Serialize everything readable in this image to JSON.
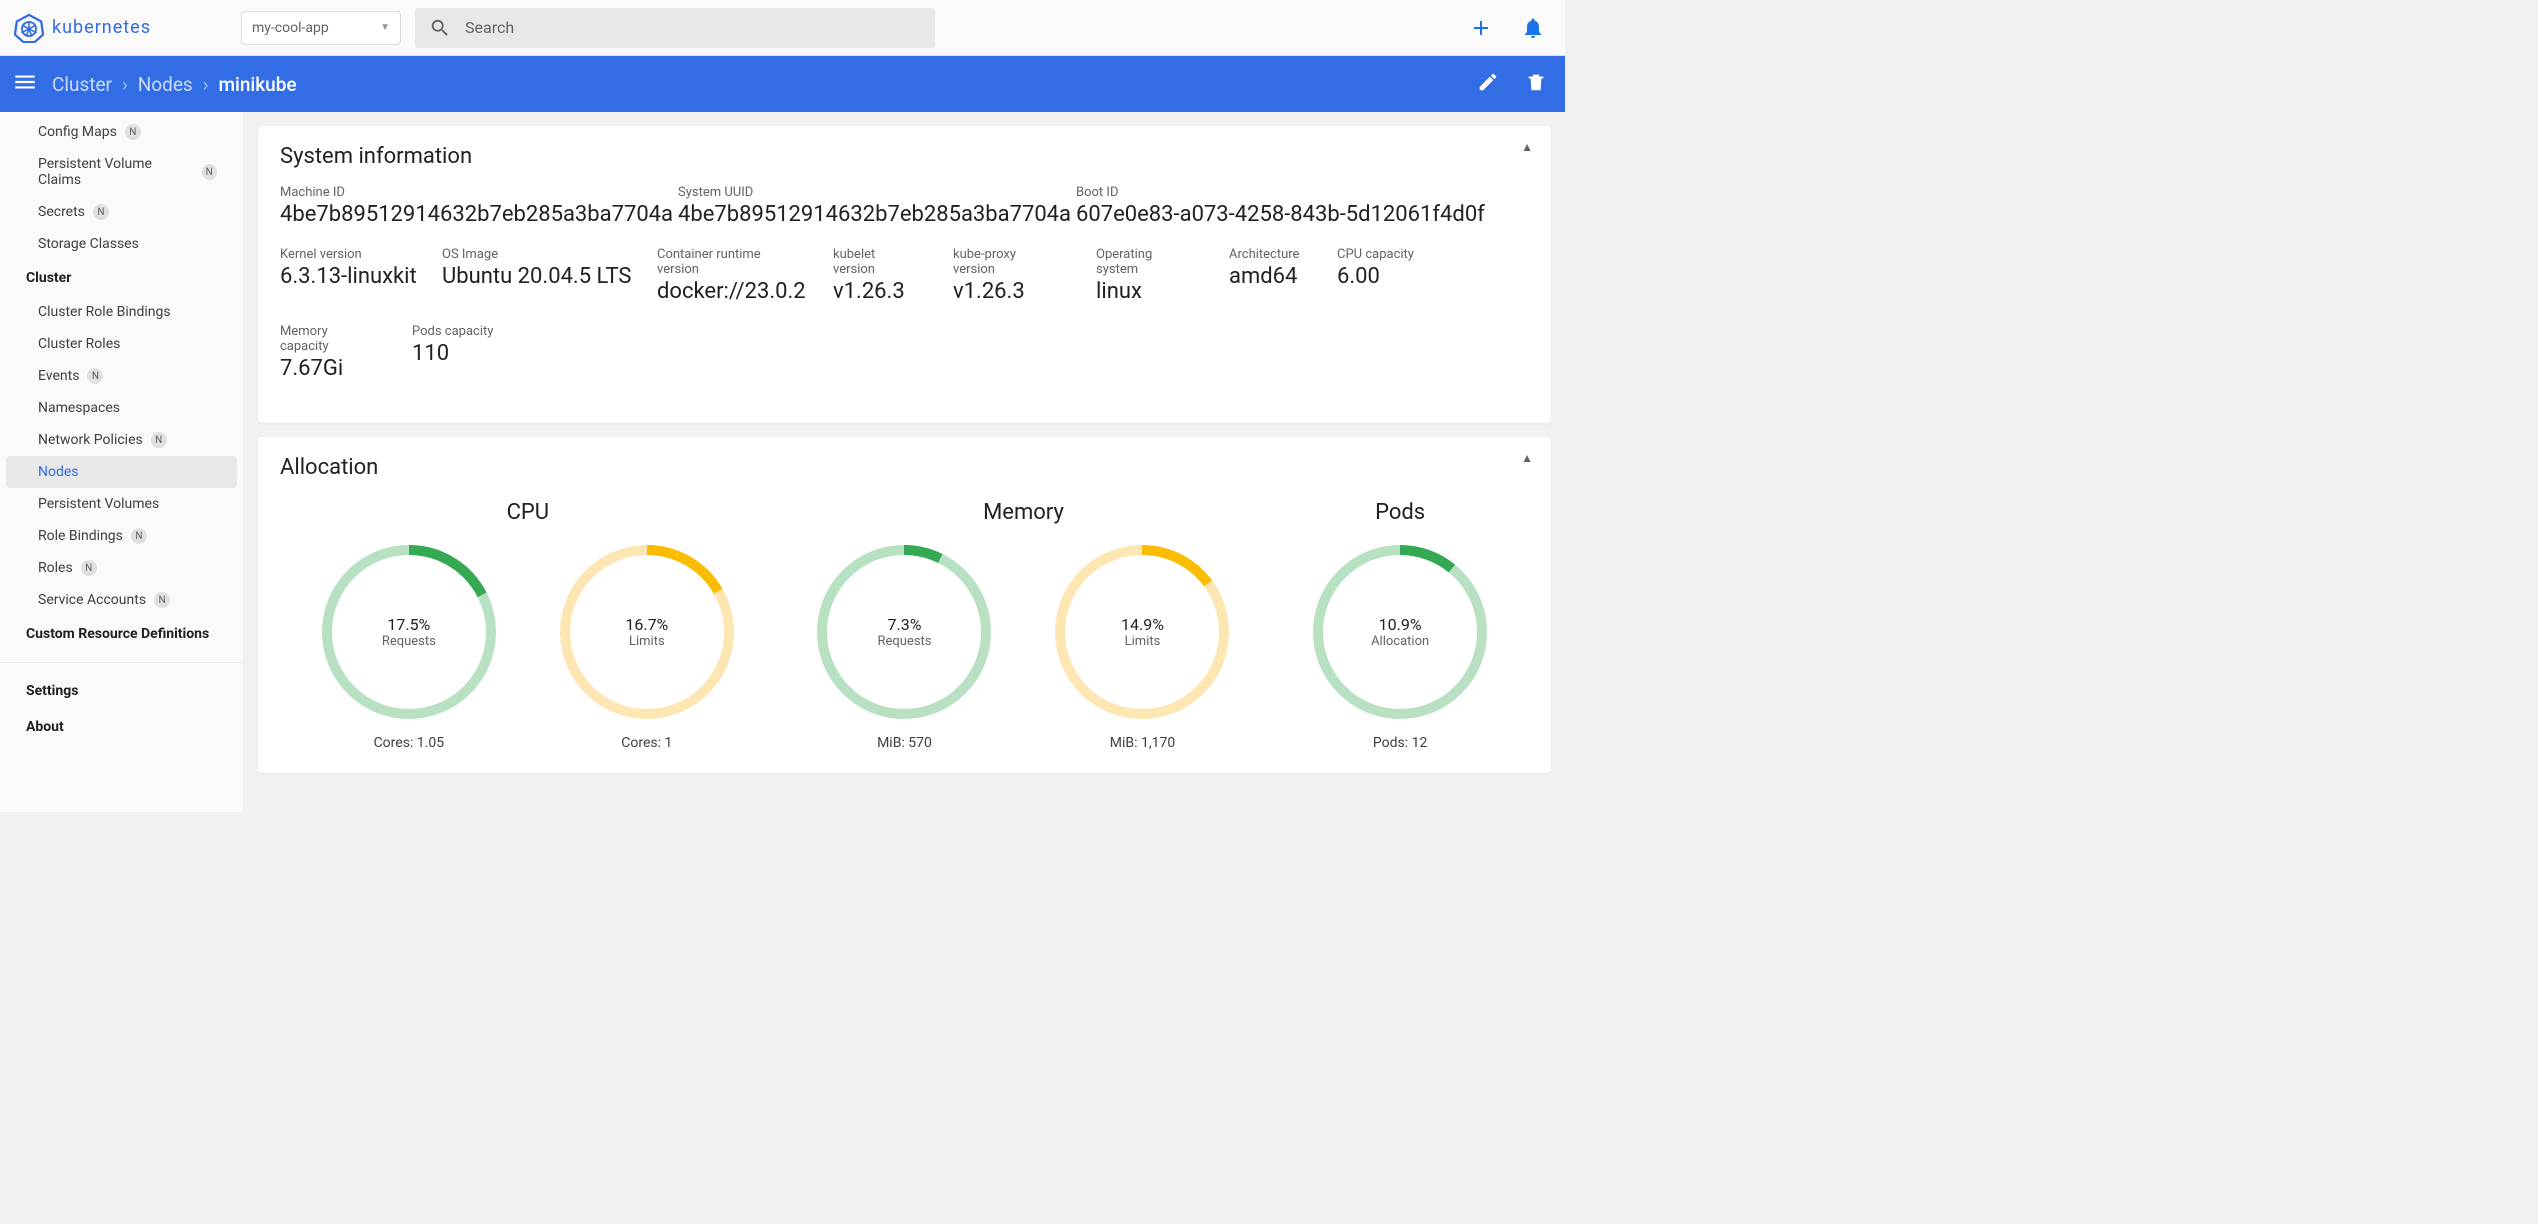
{
  "brand": "kubernetes",
  "namespace": "my-cool-app",
  "search_placeholder": "Search",
  "breadcrumb": {
    "cluster": "Cluster",
    "nodes": "Nodes",
    "current": "minikube"
  },
  "sidebar": {
    "items_top": [
      {
        "label": "Config Maps",
        "badge": "N"
      },
      {
        "label": "Persistent Volume Claims",
        "badge": "N"
      },
      {
        "label": "Secrets",
        "badge": "N"
      },
      {
        "label": "Storage Classes"
      }
    ],
    "cluster_title": "Cluster",
    "items_cluster": [
      {
        "label": "Cluster Role Bindings"
      },
      {
        "label": "Cluster Roles"
      },
      {
        "label": "Events",
        "badge": "N"
      },
      {
        "label": "Namespaces"
      },
      {
        "label": "Network Policies",
        "badge": "N"
      },
      {
        "label": "Nodes",
        "active": true
      },
      {
        "label": "Persistent Volumes"
      },
      {
        "label": "Role Bindings",
        "badge": "N"
      },
      {
        "label": "Roles",
        "badge": "N"
      },
      {
        "label": "Service Accounts",
        "badge": "N"
      }
    ],
    "crd_title": "Custom Resource Definitions",
    "settings": "Settings",
    "about": "About"
  },
  "sysinfo": {
    "title": "System information",
    "ids": {
      "machine_id_label": "Machine ID",
      "machine_id": "4be7b89512914632b7eb285a3ba7704a",
      "system_uuid_label": "System UUID",
      "system_uuid": "4be7b89512914632b7eb285a3ba7704a",
      "boot_id_label": "Boot ID",
      "boot_id": "607e0e83-a073-4258-843b-5d12061f4d0f"
    },
    "meta": {
      "kernel_label": "Kernel version",
      "kernel": "6.3.13-linuxkit",
      "os_image_label": "OS Image",
      "os_image": "Ubuntu 20.04.5 LTS",
      "crt_label": "Container runtime version",
      "crt": "docker://23.0.2",
      "kubelet_label": "kubelet version",
      "kubelet": "v1.26.3",
      "kubeproxy_label": "kube-proxy version",
      "kubeproxy": "v1.26.3",
      "os_label": "Operating system",
      "os": "linux",
      "arch_label": "Architecture",
      "arch": "amd64",
      "cpu_cap_label": "CPU capacity",
      "cpu_cap": "6.00"
    },
    "cap": {
      "mem_label": "Memory capacity",
      "mem": "7.67Gi",
      "pods_label": "Pods capacity",
      "pods": "110"
    }
  },
  "alloc": {
    "title": "Allocation",
    "cpu_title": "CPU",
    "mem_title": "Memory",
    "pods_title": "Pods"
  },
  "chart_data": [
    {
      "type": "pie",
      "group": "CPU",
      "label": "Requests",
      "percent": 17.5,
      "footer": "Cores: 1.05",
      "colors": [
        "#34a853",
        "#b7e1c2"
      ]
    },
    {
      "type": "pie",
      "group": "CPU",
      "label": "Limits",
      "percent": 16.7,
      "footer": "Cores: 1",
      "colors": [
        "#fbbc04",
        "#fde6b2"
      ]
    },
    {
      "type": "pie",
      "group": "Memory",
      "label": "Requests",
      "percent": 7.3,
      "footer": "MiB: 570",
      "colors": [
        "#34a853",
        "#b7e1c2"
      ]
    },
    {
      "type": "pie",
      "group": "Memory",
      "label": "Limits",
      "percent": 14.9,
      "footer": "MiB: 1,170",
      "colors": [
        "#fbbc04",
        "#fde6b2"
      ]
    },
    {
      "type": "pie",
      "group": "Pods",
      "label": "Allocation",
      "percent": 10.9,
      "footer": "Pods: 12",
      "colors": [
        "#34a853",
        "#b7e1c2"
      ]
    }
  ]
}
